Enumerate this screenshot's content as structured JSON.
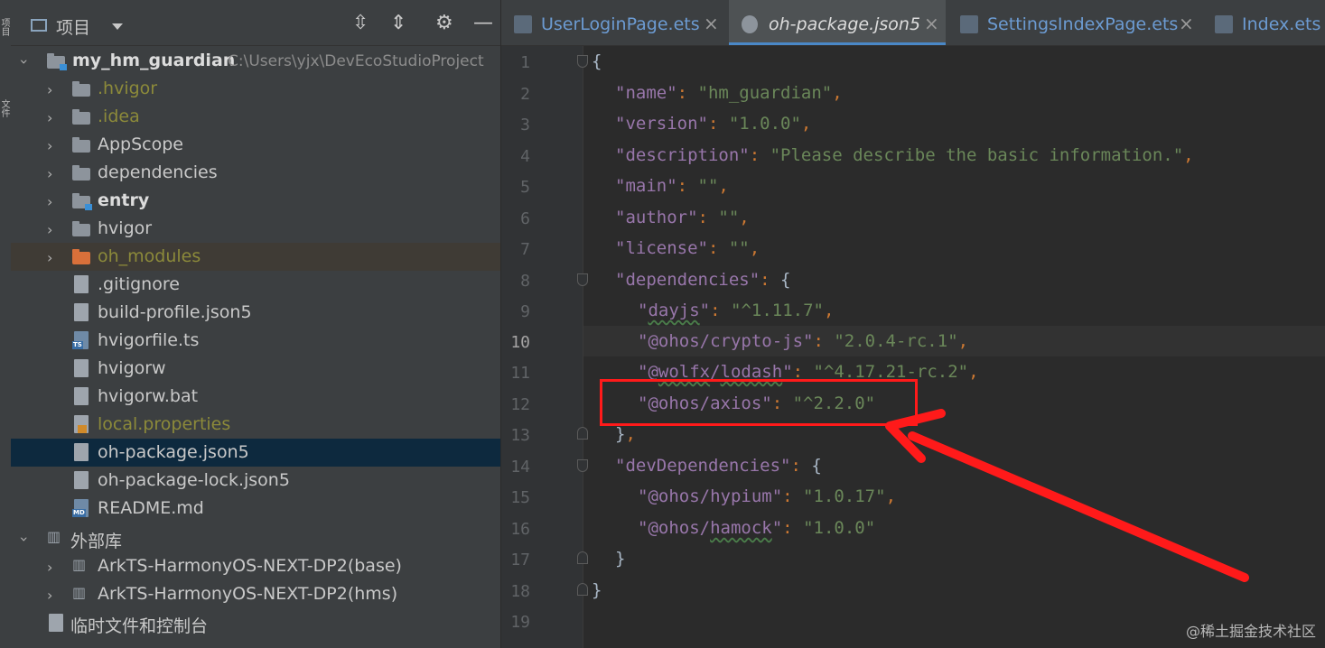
{
  "toolstrip": {
    "label_top": "项目",
    "label_mid": "文件"
  },
  "project_panel": {
    "title": "项目",
    "root": {
      "name": "my_hm_guardian",
      "path": "C:\\Users\\yjx\\DevEcoStudioProject"
    },
    "items": [
      {
        "label": ".hvigor",
        "kind": "folder"
      },
      {
        "label": ".idea",
        "kind": "folder"
      },
      {
        "label": "AppScope",
        "kind": "folder"
      },
      {
        "label": "dependencies",
        "kind": "folder"
      },
      {
        "label": "entry",
        "kind": "module"
      },
      {
        "label": "hvigor",
        "kind": "folder"
      },
      {
        "label": "oh_modules",
        "kind": "folder"
      },
      {
        "label": ".gitignore",
        "kind": "file"
      },
      {
        "label": "build-profile.json5",
        "kind": "file"
      },
      {
        "label": "hvigorfile.ts",
        "kind": "file"
      },
      {
        "label": "hvigorw",
        "kind": "file"
      },
      {
        "label": "hvigorw.bat",
        "kind": "file"
      },
      {
        "label": "local.properties",
        "kind": "file"
      },
      {
        "label": "oh-package.json5",
        "kind": "file"
      },
      {
        "label": "oh-package-lock.json5",
        "kind": "file"
      },
      {
        "label": "README.md",
        "kind": "file"
      }
    ],
    "external_libs": {
      "label": "外部库",
      "items": [
        "ArkTS-HarmonyOS-NEXT-DP2(base)",
        "ArkTS-HarmonyOS-NEXT-DP2(hms)"
      ]
    },
    "scratches": "临时文件和控制台"
  },
  "tabs": [
    {
      "label": "UserLoginPage.ets",
      "icon": "ets-file-icon"
    },
    {
      "label": "oh-package.json5",
      "icon": "json-file-icon",
      "active": true
    },
    {
      "label": "SettingsIndexPage.ets",
      "icon": "ets-file-icon"
    },
    {
      "label": "Index.ets",
      "icon": "ets-file-icon"
    }
  ],
  "editor": {
    "current_line": 10,
    "line_numbers": [
      "1",
      "2",
      "3",
      "4",
      "5",
      "6",
      "7",
      "8",
      "9",
      "10",
      "11",
      "12",
      "13",
      "14",
      "15",
      "16",
      "17",
      "18",
      "19"
    ],
    "code": {
      "l2_key": "\"name\"",
      "l2_val": "\"hm_guardian\"",
      "l3_key": "\"version\"",
      "l3_val": "\"1.0.0\"",
      "l4_key": "\"description\"",
      "l4_val": "\"Please describe the basic information.\"",
      "l5_key": "\"main\"",
      "l5_val": "\"\"",
      "l6_key": "\"author\"",
      "l6_val": "\"\"",
      "l7_key": "\"license\"",
      "l7_val": "\"\"",
      "l8_key": "\"dependencies\"",
      "l9_q1": "\"",
      "l9_key": "dayjs",
      "l9_q2": "\"",
      "l9_val": "\"^1.11.7\"",
      "l10_key": "\"@ohos/crypto-js\"",
      "l10_val": "\"2.0.4-rc.1\"",
      "l11_q1": "\"@",
      "l11_key": "wolfx",
      "l11_slash": "/",
      "l11_key2": "lodash",
      "l11_q2": "\"",
      "l11_val": "\"^4.17.21-rc.2\"",
      "l12_key": "\"@ohos/axios\"",
      "l12_val": "\"^2.2.0\"",
      "l14_key": "\"devDependencies\"",
      "l15_key": "\"@ohos/hypium\"",
      "l15_val": "\"1.0.17\"",
      "l16_q1": "\"@ohos/",
      "l16_key": "hamock",
      "l16_q2": "\"",
      "l16_val": "\"1.0.0\""
    }
  },
  "watermark": "@稀土掘金技术社区",
  "colors": {
    "highlight_box": "#ff1a1a",
    "selection": "#0d293e",
    "tab_underline": "#4a88c7"
  }
}
